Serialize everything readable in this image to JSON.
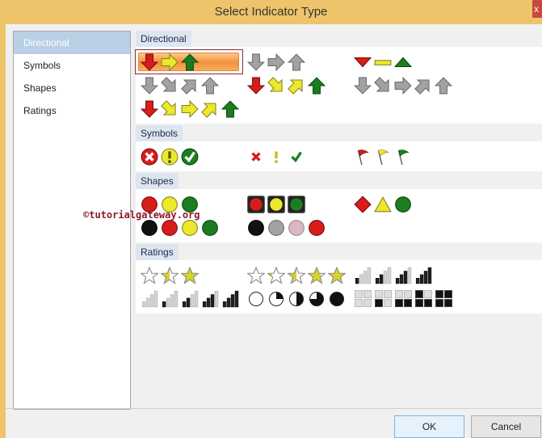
{
  "window": {
    "title": "Select Indicator Type",
    "close_label": "x"
  },
  "sidebar": {
    "items": [
      {
        "label": "Directional",
        "selected": true
      },
      {
        "label": "Symbols"
      },
      {
        "label": "Shapes"
      },
      {
        "label": "Ratings"
      }
    ]
  },
  "sections": [
    {
      "title": "Directional",
      "rows": [
        [
          [
            "arrow down red",
            "arrow right yellow",
            "arrow up green"
          ],
          [
            "arrow down gray",
            "arrow right gray",
            "arrow up gray"
          ],
          [
            "tri down red",
            "bar flat yellow",
            "tri up green"
          ]
        ],
        [
          [
            "arrow down gray",
            "arrow downright gray",
            "arrow upright gray",
            "arrow up gray"
          ],
          [
            "arrow down red",
            "arrow downright yellow",
            "arrow upright yellow",
            "arrow up green"
          ],
          [
            "arrow down gray",
            "arrow downright gray",
            "arrow right gray",
            "arrow upright gray",
            "arrow up gray"
          ]
        ],
        [
          [
            "arrow down red",
            "arrow downright yellow",
            "arrow right yellow",
            "arrow upright yellow",
            "arrow up green"
          ],
          [],
          []
        ]
      ]
    },
    {
      "title": "Symbols",
      "rows": [
        [
          [
            "csym x red",
            "csym ! yellow",
            "csym check green"
          ],
          [
            "sym x red",
            "sym ! yellow",
            "sym check green"
          ],
          [
            "flag red",
            "flag yellow",
            "flag green"
          ]
        ]
      ]
    },
    {
      "title": "Shapes",
      "rows": [
        [
          [
            "circle red",
            "circle yellow",
            "circle green"
          ],
          [
            "light red",
            "light yellow",
            "light green"
          ],
          [
            "diamond red",
            "triangle yellow",
            "circle green"
          ]
        ],
        [
          [
            "circle black",
            "circle red",
            "circle yellow",
            "circle green"
          ],
          [
            "circle black",
            "circle gray",
            "circle pink",
            "circle red"
          ],
          []
        ]
      ]
    },
    {
      "title": "Ratings",
      "rows": [
        [
          [
            "star 0",
            "star 0.5",
            "star 1"
          ],
          [
            "star 0",
            "star 0.25",
            "star 0.5",
            "star 0.75",
            "star 1"
          ],
          [
            "signal 1",
            "signal 2",
            "signal 3",
            "signal 4"
          ]
        ],
        [
          [
            "signal 0",
            "signal 1",
            "signal 2",
            "signal 3",
            "signal 4"
          ],
          [
            "pie 0",
            "pie 1",
            "pie 2",
            "pie 3",
            "pie 4"
          ],
          [
            "quad 0",
            "quad 1",
            "quad 2",
            "quad 3",
            "quad 4"
          ]
        ]
      ]
    }
  ],
  "selected_indicator": "Directional 3 arrows (colored)",
  "watermark": "©tutorialgateway.org",
  "buttons": {
    "ok": "OK",
    "cancel": "Cancel"
  },
  "colors": {
    "red": "#d81c1c",
    "yellow": "#ece82c",
    "green": "#1b7d1f",
    "gray": "#a2a2a2",
    "black": "#111111",
    "pink": "#d9b8c0",
    "accent": "#eec46a"
  }
}
